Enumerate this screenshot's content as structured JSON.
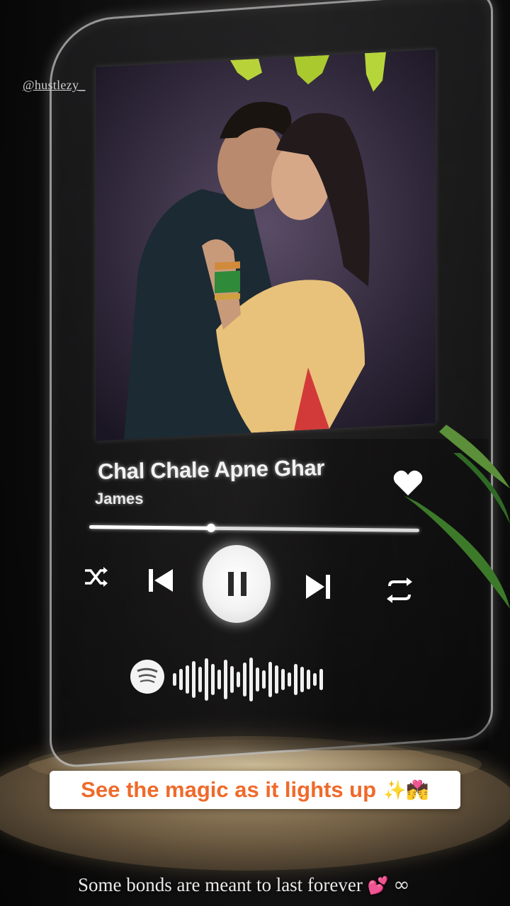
{
  "watermark": "@hustlezy_",
  "player": {
    "song_title": "Chal Chale Apne Ghar",
    "artist": "James",
    "progress": 0.37,
    "icons": [
      "shuffle-icon",
      "previous-icon",
      "pause-icon",
      "next-icon",
      "repeat-icon",
      "heart-icon",
      "spotify-logo-icon"
    ]
  },
  "caption": {
    "text": "See the magic as it lights up",
    "emoji": "✨💏"
  },
  "bottom_caption": {
    "text": "Some bonds are meant to last forever",
    "emoji": "💕",
    "symbol": "∞"
  },
  "colors": {
    "caption_text": "#ef6a2a",
    "caption_bg": "#ffffff",
    "background": "#151414"
  }
}
